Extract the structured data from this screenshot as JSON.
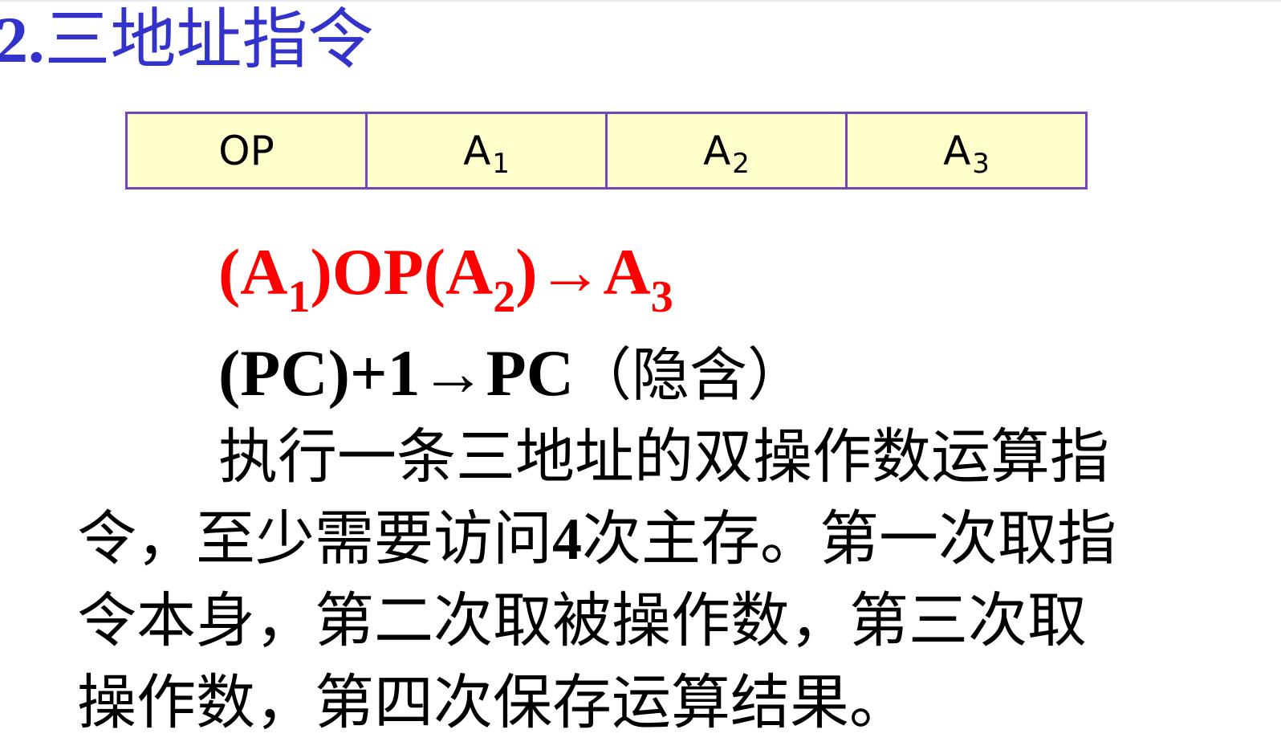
{
  "title": {
    "number": "2.",
    "text": "三地址指令"
  },
  "format_fields": [
    {
      "main": "OP",
      "sub": ""
    },
    {
      "main": "A",
      "sub": "1"
    },
    {
      "main": "A",
      "sub": "2"
    },
    {
      "main": "A",
      "sub": "3"
    }
  ],
  "equation1": {
    "p1": "(A",
    "s1": "1",
    "p2": ")OP(A",
    "s2": "2",
    "p3": ")→A",
    "s3": "3"
  },
  "equation2": {
    "formula": "(PC)+1→PC",
    "note": "（隐含）"
  },
  "description": {
    "line1": "执行一条三地址的双操作数运算指",
    "line2_a": "令，至少需要访问",
    "line2_b": "4",
    "line2_c": "次主存。第一次取指",
    "line3": "令本身，第二次取被操作数，第三次取",
    "line4": "操作数，第四次保存运算结果。"
  },
  "colors": {
    "title": "#3333cc",
    "equation_highlight": "#ff0000",
    "table_fill": "#ffffcc",
    "table_border": "#7744bb"
  }
}
